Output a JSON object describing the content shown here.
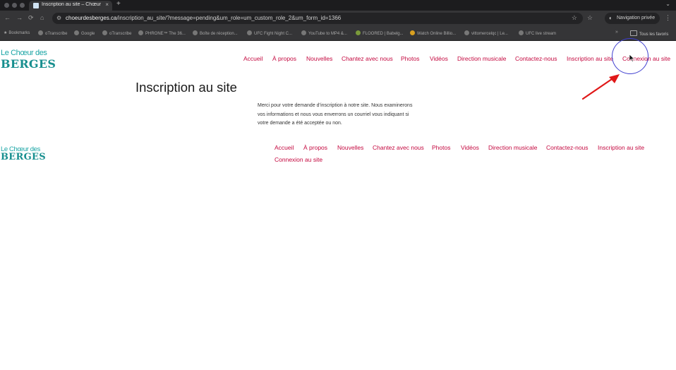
{
  "browser": {
    "tab": {
      "title": "Inscription au site – Chœur d...",
      "close": "×"
    },
    "new_tab": "+",
    "tab_menu": "⌄",
    "url": {
      "host": "choeurdesberges.ca",
      "path": "/inscription_au_site/?message=pending&um_role=um_custom_role_2&um_form_id=1366"
    },
    "private_label": "Navigation privée",
    "bookmarks": [
      "Bookmarks",
      "oTranscribe",
      "Google",
      "oTranscribe",
      "PHRONE™ The 36...",
      "Boîte de réception...",
      "UFC Fight Night C...",
      "YouTube to MP4 &...",
      "FLOORED | Babelg...",
      "Watch Online Billio...",
      "vittomercelqc | Le...",
      "UFC live stream"
    ],
    "all_bookmarks": "Tous les favoris"
  },
  "site": {
    "logo": {
      "line1": "Le Chœur des",
      "line2": "BERGES"
    },
    "nav": [
      "Accueil",
      "À propos",
      "Nouvelles",
      "Chantez avec nous",
      "Photos",
      "Vidéos",
      "Direction musicale",
      "Contactez-nous",
      "Inscription au site",
      "Connexion au site"
    ],
    "page_title": "Inscription au site",
    "message": "Merci pour votre demande d’inscription à notre site. Nous examinerons vos informations et nous vous enverrons un courriel vous indiquant si votre demande a été acceptée ou non."
  },
  "colors": {
    "link": "#c4083f",
    "logo": "#178f8f",
    "annotation_circle": "#4040d0",
    "annotation_arrow": "#e01818"
  }
}
